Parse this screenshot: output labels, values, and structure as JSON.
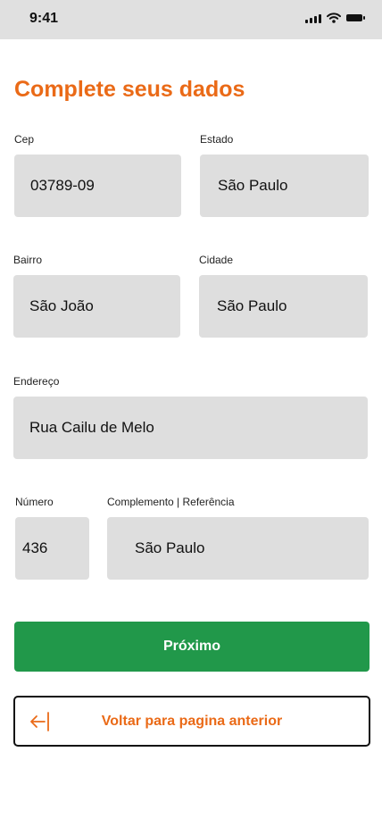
{
  "status_bar": {
    "time": "9:41",
    "icons": [
      "signal-icon",
      "wifi-icon",
      "battery-icon"
    ]
  },
  "page": {
    "title": "Complete seus dados"
  },
  "form": {
    "cep": {
      "label": "Cep",
      "value": "03789-09"
    },
    "estado": {
      "label": "Estado",
      "value": "São Paulo"
    },
    "bairro": {
      "label": "Bairro",
      "value": "São João"
    },
    "cidade": {
      "label": "Cidade",
      "value": "São Paulo"
    },
    "endereco": {
      "label": "Endereço",
      "value": "Rua Cailu de Melo"
    },
    "numero": {
      "label": "Número",
      "value": "436"
    },
    "complemento": {
      "label": "Complemento | Referência",
      "value": "São Paulo"
    }
  },
  "actions": {
    "next_label": "Próximo",
    "back_label": "Voltar para pagina anterior",
    "back_icon": "arrow-left-icon"
  },
  "colors": {
    "accent": "#ea6a17",
    "primary_button": "#21984a",
    "input_background": "#dedede",
    "status_bar_background": "#e0e0e0"
  }
}
